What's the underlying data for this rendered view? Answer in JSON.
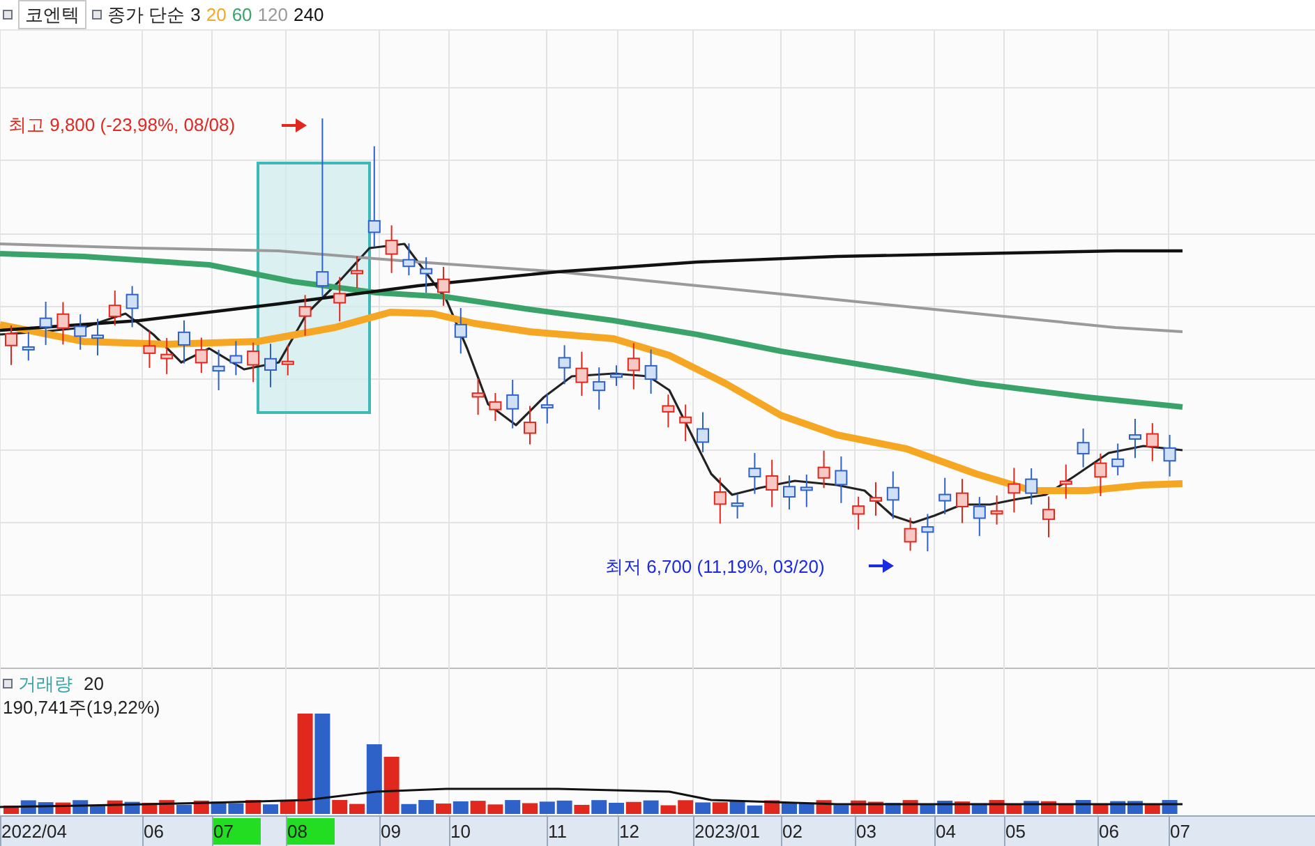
{
  "legend": {
    "stock_name": "코엔텍",
    "label": "종가 단순",
    "moving_averages": [
      {
        "period": "3",
        "color": "#222222"
      },
      {
        "period": "20",
        "color": "#f5a623"
      },
      {
        "period": "60",
        "color": "#3aa36a"
      },
      {
        "period": "120",
        "color": "#9a9a9a"
      },
      {
        "period": "240",
        "color": "#111111"
      }
    ]
  },
  "annotations": {
    "high": "최고 9,800 (-23,98%, 08/08)",
    "low": "최저 6,700 (11,19%, 03/20)"
  },
  "volume_legend": {
    "label": "거래량",
    "period": "20",
    "reading": "190,741주(19,22%)"
  },
  "x_axis": [
    {
      "label": "2022/04",
      "highlighted": false
    },
    {
      "label": "06",
      "highlighted": false
    },
    {
      "label": "07",
      "highlighted": true
    },
    {
      "label": "08",
      "highlighted": true
    },
    {
      "label": "09",
      "highlighted": false
    },
    {
      "label": "10",
      "highlighted": false
    },
    {
      "label": "11",
      "highlighted": false
    },
    {
      "label": "12",
      "highlighted": false
    },
    {
      "label": "2023/01",
      "highlighted": false
    },
    {
      "label": "02",
      "highlighted": false
    },
    {
      "label": "03",
      "highlighted": false
    },
    {
      "label": "04",
      "highlighted": false
    },
    {
      "label": "05",
      "highlighted": false
    },
    {
      "label": "06",
      "highlighted": false
    },
    {
      "label": "07",
      "highlighted": false
    }
  ]
}
